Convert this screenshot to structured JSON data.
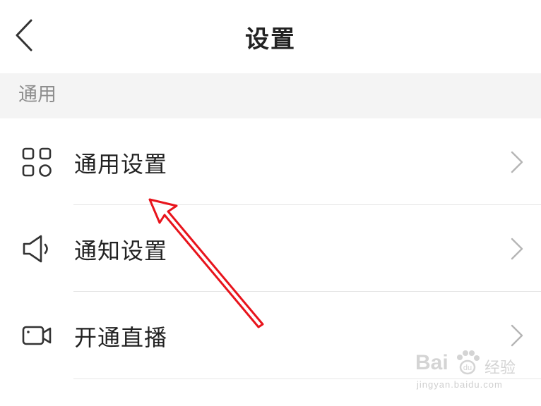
{
  "header": {
    "title": "设置"
  },
  "section": {
    "label": "通用"
  },
  "rows": [
    {
      "label": "通用设置",
      "icon": "grid-icon"
    },
    {
      "label": "通知设置",
      "icon": "speaker-icon"
    },
    {
      "label": "开通直播",
      "icon": "video-camera-icon"
    }
  ],
  "annotation": {
    "color": "#e8141c"
  },
  "watermark": {
    "brand": "Bai",
    "suffix": "经验",
    "url": "jingyan.baidu.com"
  }
}
